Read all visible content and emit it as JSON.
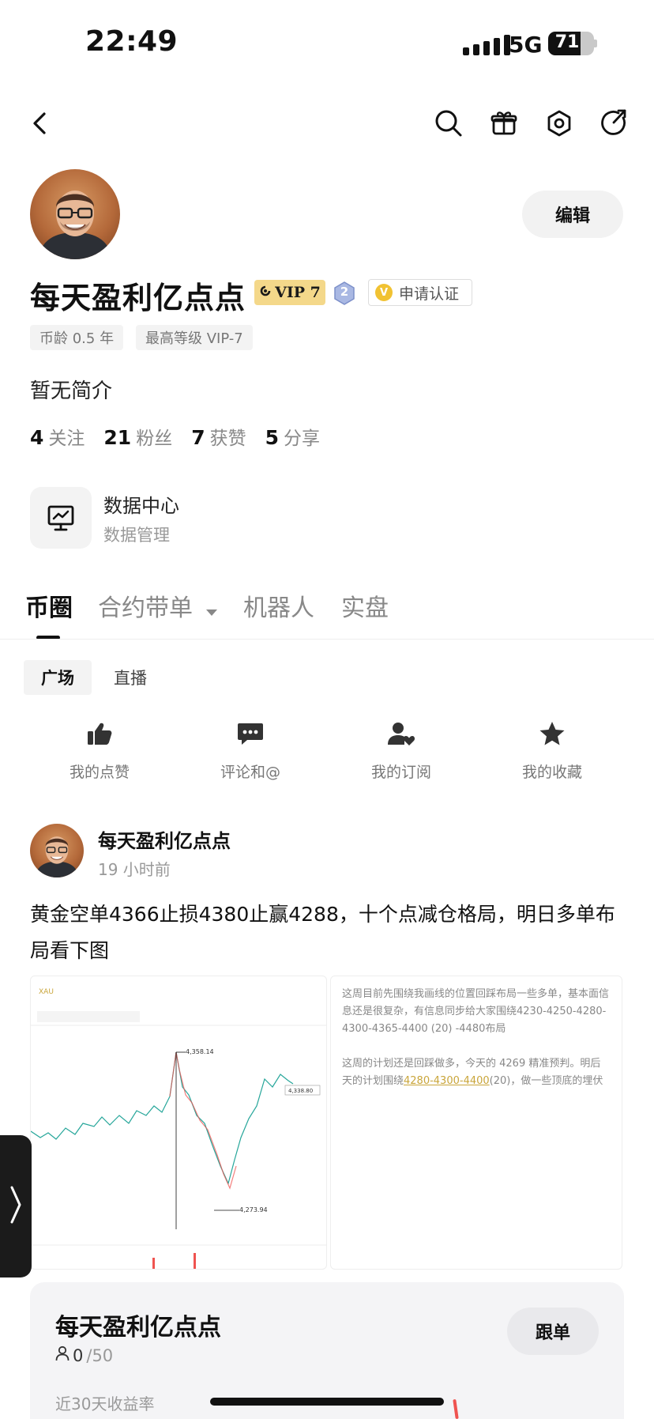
{
  "status_bar": {
    "time": "22:49",
    "network": "5G",
    "battery": "71"
  },
  "profile": {
    "username": "每天盈利亿点点",
    "vip": "VIP 7",
    "level": "2",
    "verify": "申请认证",
    "tags": [
      "币龄 0.5 年",
      "最高等级 VIP-7"
    ],
    "bio": "暂无简介",
    "edit_label": "编辑",
    "stats": [
      {
        "num": "4",
        "label": "关注"
      },
      {
        "num": "21",
        "label": "粉丝"
      },
      {
        "num": "7",
        "label": "获赞"
      },
      {
        "num": "5",
        "label": "分享"
      }
    ]
  },
  "data_center": {
    "title": "数据中心",
    "subtitle": "数据管理"
  },
  "tabs": [
    "币圈",
    "合约带单",
    "机器人",
    "实盘"
  ],
  "subtabs": [
    "广场",
    "直播"
  ],
  "quick_actions": [
    "我的点赞",
    "评论和@",
    "我的订阅",
    "我的收藏"
  ],
  "post": {
    "author": "每天盈利亿点点",
    "time": "19 小时前",
    "text": "黄金空单4366止损4380止赢4288，十个点减仓格局，明日多单布局看下图",
    "chart_image": {
      "symbol": "XAU",
      "high_label": "4,358.14",
      "low_label": "4,273.94",
      "price_tag": "4,338.80"
    },
    "note_image": {
      "para1": "这周目前先围绕我画线的位置回踩布局一些多单，基本面信息还是很复杂，有信息同步给大家围绕4230-4250-4280-4300-4365-4400 (20) -4480布局",
      "para2_a": "这周的计划还是回踩做多，今天的 4269 精准预判。明后天的计划围绕",
      "para2_hl": "4280-4300-4400",
      "para2_b": "(20)，做一些顶底的埋伏"
    }
  },
  "copy_card": {
    "name": "每天盈利亿点点",
    "count": "0",
    "max": "/50",
    "follow_label": "跟单",
    "metric_label": "近30天收益率"
  },
  "colors": {
    "vip_gold": "#f4d88a",
    "up": "#26a69a",
    "down": "#ef5350",
    "text": "#111111"
  }
}
